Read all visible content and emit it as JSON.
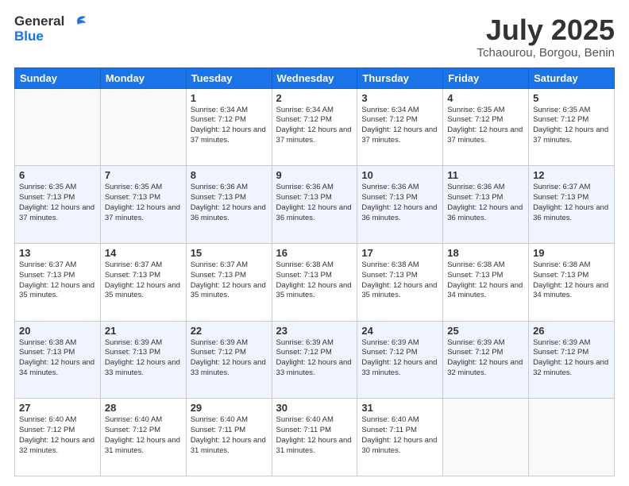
{
  "header": {
    "logo_line1": "General",
    "logo_line2": "Blue",
    "title": "July 2025",
    "location": "Tchaourou, Borgou, Benin"
  },
  "days_of_week": [
    "Sunday",
    "Monday",
    "Tuesday",
    "Wednesday",
    "Thursday",
    "Friday",
    "Saturday"
  ],
  "weeks": [
    [
      {
        "day": "",
        "sunrise": "",
        "sunset": "",
        "daylight": ""
      },
      {
        "day": "",
        "sunrise": "",
        "sunset": "",
        "daylight": ""
      },
      {
        "day": "1",
        "sunrise": "Sunrise: 6:34 AM",
        "sunset": "Sunset: 7:12 PM",
        "daylight": "Daylight: 12 hours and 37 minutes."
      },
      {
        "day": "2",
        "sunrise": "Sunrise: 6:34 AM",
        "sunset": "Sunset: 7:12 PM",
        "daylight": "Daylight: 12 hours and 37 minutes."
      },
      {
        "day": "3",
        "sunrise": "Sunrise: 6:34 AM",
        "sunset": "Sunset: 7:12 PM",
        "daylight": "Daylight: 12 hours and 37 minutes."
      },
      {
        "day": "4",
        "sunrise": "Sunrise: 6:35 AM",
        "sunset": "Sunset: 7:12 PM",
        "daylight": "Daylight: 12 hours and 37 minutes."
      },
      {
        "day": "5",
        "sunrise": "Sunrise: 6:35 AM",
        "sunset": "Sunset: 7:12 PM",
        "daylight": "Daylight: 12 hours and 37 minutes."
      }
    ],
    [
      {
        "day": "6",
        "sunrise": "Sunrise: 6:35 AM",
        "sunset": "Sunset: 7:13 PM",
        "daylight": "Daylight: 12 hours and 37 minutes."
      },
      {
        "day": "7",
        "sunrise": "Sunrise: 6:35 AM",
        "sunset": "Sunset: 7:13 PM",
        "daylight": "Daylight: 12 hours and 37 minutes."
      },
      {
        "day": "8",
        "sunrise": "Sunrise: 6:36 AM",
        "sunset": "Sunset: 7:13 PM",
        "daylight": "Daylight: 12 hours and 36 minutes."
      },
      {
        "day": "9",
        "sunrise": "Sunrise: 6:36 AM",
        "sunset": "Sunset: 7:13 PM",
        "daylight": "Daylight: 12 hours and 36 minutes."
      },
      {
        "day": "10",
        "sunrise": "Sunrise: 6:36 AM",
        "sunset": "Sunset: 7:13 PM",
        "daylight": "Daylight: 12 hours and 36 minutes."
      },
      {
        "day": "11",
        "sunrise": "Sunrise: 6:36 AM",
        "sunset": "Sunset: 7:13 PM",
        "daylight": "Daylight: 12 hours and 36 minutes."
      },
      {
        "day": "12",
        "sunrise": "Sunrise: 6:37 AM",
        "sunset": "Sunset: 7:13 PM",
        "daylight": "Daylight: 12 hours and 36 minutes."
      }
    ],
    [
      {
        "day": "13",
        "sunrise": "Sunrise: 6:37 AM",
        "sunset": "Sunset: 7:13 PM",
        "daylight": "Daylight: 12 hours and 35 minutes."
      },
      {
        "day": "14",
        "sunrise": "Sunrise: 6:37 AM",
        "sunset": "Sunset: 7:13 PM",
        "daylight": "Daylight: 12 hours and 35 minutes."
      },
      {
        "day": "15",
        "sunrise": "Sunrise: 6:37 AM",
        "sunset": "Sunset: 7:13 PM",
        "daylight": "Daylight: 12 hours and 35 minutes."
      },
      {
        "day": "16",
        "sunrise": "Sunrise: 6:38 AM",
        "sunset": "Sunset: 7:13 PM",
        "daylight": "Daylight: 12 hours and 35 minutes."
      },
      {
        "day": "17",
        "sunrise": "Sunrise: 6:38 AM",
        "sunset": "Sunset: 7:13 PM",
        "daylight": "Daylight: 12 hours and 35 minutes."
      },
      {
        "day": "18",
        "sunrise": "Sunrise: 6:38 AM",
        "sunset": "Sunset: 7:13 PM",
        "daylight": "Daylight: 12 hours and 34 minutes."
      },
      {
        "day": "19",
        "sunrise": "Sunrise: 6:38 AM",
        "sunset": "Sunset: 7:13 PM",
        "daylight": "Daylight: 12 hours and 34 minutes."
      }
    ],
    [
      {
        "day": "20",
        "sunrise": "Sunrise: 6:38 AM",
        "sunset": "Sunset: 7:13 PM",
        "daylight": "Daylight: 12 hours and 34 minutes."
      },
      {
        "day": "21",
        "sunrise": "Sunrise: 6:39 AM",
        "sunset": "Sunset: 7:13 PM",
        "daylight": "Daylight: 12 hours and 33 minutes."
      },
      {
        "day": "22",
        "sunrise": "Sunrise: 6:39 AM",
        "sunset": "Sunset: 7:12 PM",
        "daylight": "Daylight: 12 hours and 33 minutes."
      },
      {
        "day": "23",
        "sunrise": "Sunrise: 6:39 AM",
        "sunset": "Sunset: 7:12 PM",
        "daylight": "Daylight: 12 hours and 33 minutes."
      },
      {
        "day": "24",
        "sunrise": "Sunrise: 6:39 AM",
        "sunset": "Sunset: 7:12 PM",
        "daylight": "Daylight: 12 hours and 33 minutes."
      },
      {
        "day": "25",
        "sunrise": "Sunrise: 6:39 AM",
        "sunset": "Sunset: 7:12 PM",
        "daylight": "Daylight: 12 hours and 32 minutes."
      },
      {
        "day": "26",
        "sunrise": "Sunrise: 6:39 AM",
        "sunset": "Sunset: 7:12 PM",
        "daylight": "Daylight: 12 hours and 32 minutes."
      }
    ],
    [
      {
        "day": "27",
        "sunrise": "Sunrise: 6:40 AM",
        "sunset": "Sunset: 7:12 PM",
        "daylight": "Daylight: 12 hours and 32 minutes."
      },
      {
        "day": "28",
        "sunrise": "Sunrise: 6:40 AM",
        "sunset": "Sunset: 7:12 PM",
        "daylight": "Daylight: 12 hours and 31 minutes."
      },
      {
        "day": "29",
        "sunrise": "Sunrise: 6:40 AM",
        "sunset": "Sunset: 7:11 PM",
        "daylight": "Daylight: 12 hours and 31 minutes."
      },
      {
        "day": "30",
        "sunrise": "Sunrise: 6:40 AM",
        "sunset": "Sunset: 7:11 PM",
        "daylight": "Daylight: 12 hours and 31 minutes."
      },
      {
        "day": "31",
        "sunrise": "Sunrise: 6:40 AM",
        "sunset": "Sunset: 7:11 PM",
        "daylight": "Daylight: 12 hours and 30 minutes."
      },
      {
        "day": "",
        "sunrise": "",
        "sunset": "",
        "daylight": ""
      },
      {
        "day": "",
        "sunrise": "",
        "sunset": "",
        "daylight": ""
      }
    ]
  ]
}
